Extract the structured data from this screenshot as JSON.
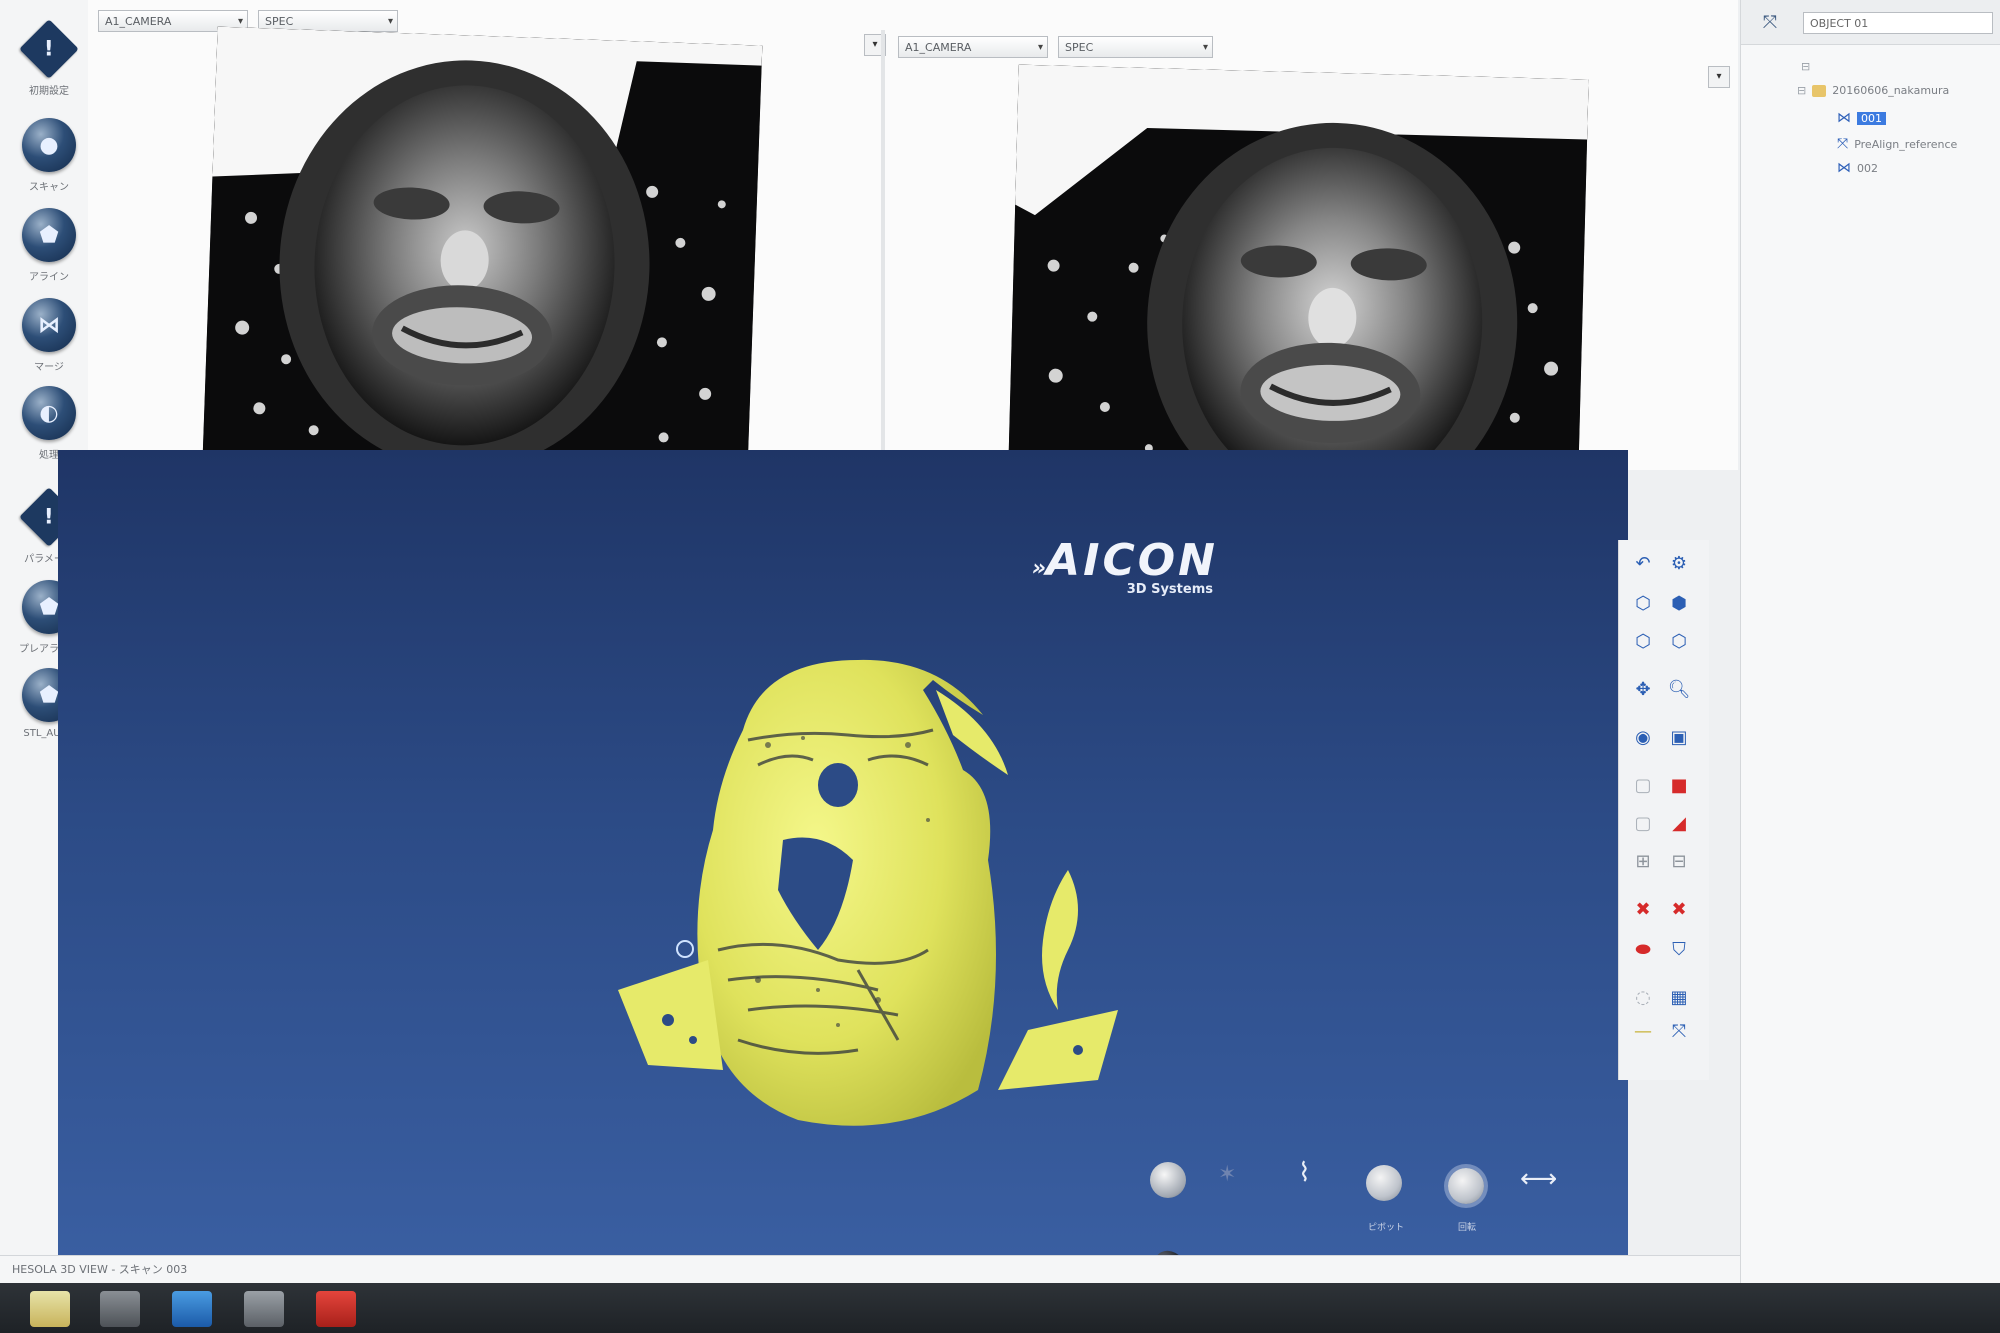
{
  "sidebar": {
    "items": [
      {
        "label": "初期設定",
        "icon": "warning-diamond-icon",
        "glyph": "!"
      },
      {
        "label": "スキャン",
        "icon": "scan-sphere-icon",
        "glyph": "●"
      },
      {
        "label": "アライン",
        "icon": "align-icon",
        "glyph": "⬟"
      },
      {
        "label": "マージ",
        "icon": "merge-icon",
        "glyph": "⋈"
      },
      {
        "label": "処理",
        "icon": "process-icon",
        "glyph": "◐"
      },
      {
        "label": "パラメータ",
        "icon": "warning-diamond-icon",
        "glyph": "!"
      },
      {
        "label": "プレアライン",
        "icon": "prealign-icon",
        "glyph": "⬟"
      },
      {
        "label": "STL_AUTO",
        "icon": "stl-auto-icon",
        "glyph": "⬟"
      }
    ]
  },
  "camera_panes": {
    "left": {
      "camera_select": "A1_CAMERA",
      "mode_select": "SPEC"
    },
    "right": {
      "camera_select": "A1_CAMERA",
      "mode_select": "SPEC"
    }
  },
  "tree": {
    "search_value": "OBJECT 01",
    "rows": [
      "20160606_nakamura",
      "001",
      "PreAlign_reference",
      "002"
    ]
  },
  "viewport": {
    "brand": "AICON",
    "brand_sub": "3D Systems",
    "bottom_tool_labels": [
      "ピボット",
      "回転"
    ]
  },
  "statusbar": {
    "text": "HESOLA 3D VIEW - スキャン 003"
  },
  "colors": {
    "viewport_top": "#1f3566",
    "viewport_bottom": "#3a5fa2",
    "mesh": "#e6ea6a",
    "sidebar_button": "#1d3960",
    "toolbar_red": "#d62a2a"
  }
}
